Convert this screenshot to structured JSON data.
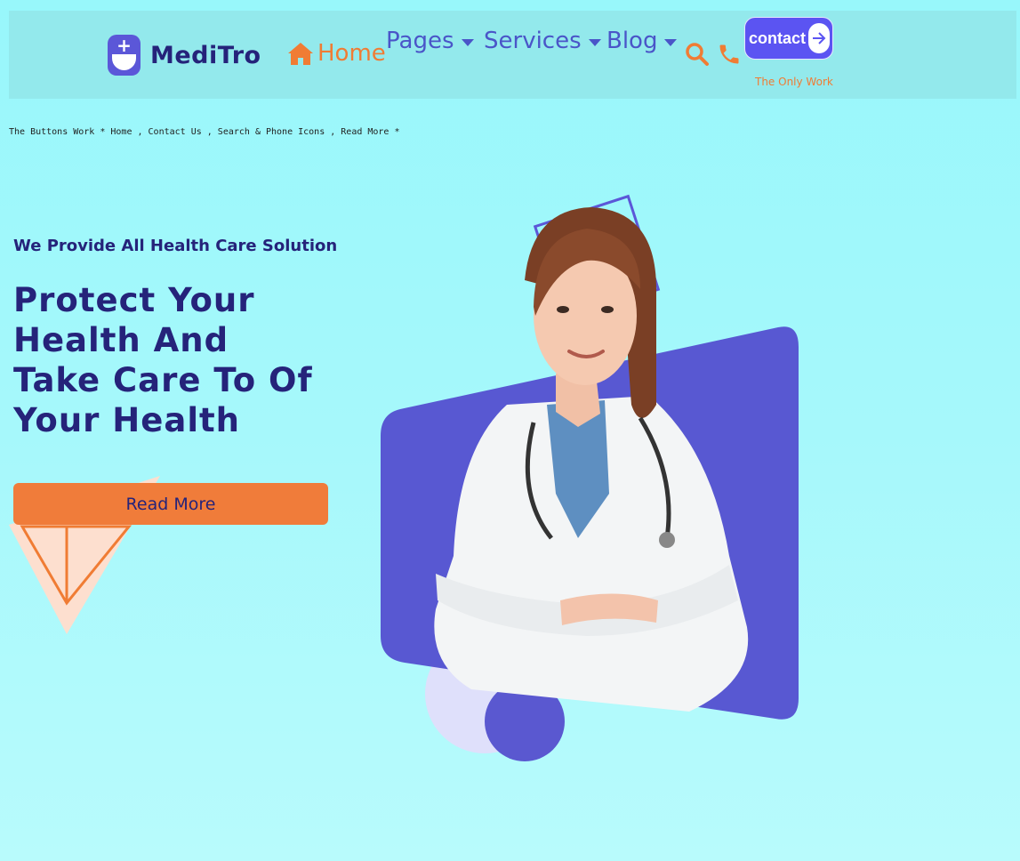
{
  "navbar": {
    "brand": "MediTro",
    "home_label": "Home",
    "pages_label": "Pages",
    "services_label": "Services",
    "blog_label": "Blog",
    "contact_label": "contact",
    "contact_note": "The Only Work",
    "icons": [
      "home-icon",
      "search-icon",
      "phone-icon",
      "arrow-right-icon",
      "chevron-down-icon"
    ]
  },
  "notice": "The Buttons Work * Home , Contact Us , Search & Phone Icons , Read More *",
  "hero": {
    "tagline": "We Provide All Health Care Solution",
    "headline": "Protect Your Health And Take Care To Of Your Health",
    "cta_label": "Read More"
  },
  "colors": {
    "background": "#98f7fb",
    "navbar_bg": "#93e9ec",
    "brand_dark": "#25237a",
    "accent_orange": "#f07c34",
    "accent_purple": "#5b54f2",
    "nav_blue": "#4a55c8"
  }
}
